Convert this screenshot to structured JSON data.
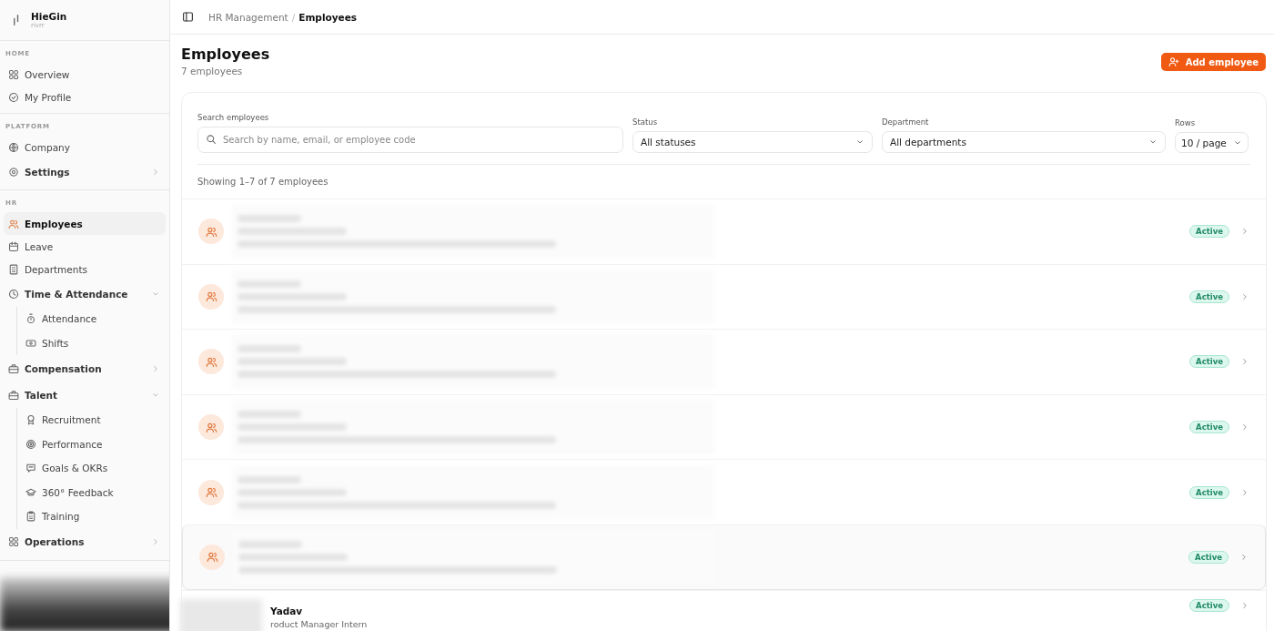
{
  "brand": {
    "name": "HieGin",
    "sub": "rivrr"
  },
  "sidebar": {
    "sections": [
      {
        "heading": "HOME",
        "items": [
          {
            "label": "Overview",
            "selected": false
          },
          {
            "label": "My Profile",
            "selected": false
          }
        ]
      },
      {
        "heading": "PLATFORM",
        "items": [
          {
            "label": "Company",
            "selected": false
          },
          {
            "label": "Settings",
            "selected": false,
            "expanded": false,
            "group": true
          }
        ]
      },
      {
        "heading": "HR",
        "items": [
          {
            "label": "Employees",
            "selected": true
          },
          {
            "label": "Leave",
            "selected": false
          },
          {
            "label": "Departments",
            "selected": false
          },
          {
            "label": "Time & Attendance",
            "selected": false,
            "group": true,
            "expanded": true,
            "children": [
              {
                "label": "Attendance",
                "selected": false
              },
              {
                "label": "Shifts",
                "selected": false
              }
            ]
          },
          {
            "label": "Compensation",
            "selected": false,
            "group": true,
            "expanded": false
          },
          {
            "label": "Talent",
            "selected": false,
            "group": true,
            "expanded": true,
            "children": [
              {
                "label": "Recruitment",
                "selected": false
              },
              {
                "label": "Performance",
                "selected": false
              },
              {
                "label": "Goals & OKRs",
                "selected": false
              },
              {
                "label": "360° Feedback",
                "selected": false
              },
              {
                "label": "Training",
                "selected": false
              }
            ]
          },
          {
            "label": "Operations",
            "selected": false,
            "group": true,
            "expanded": false
          }
        ]
      }
    ]
  },
  "breadcrumb": {
    "items": [
      "HR Management",
      "Employees"
    ],
    "separator": "/"
  },
  "page": {
    "title": "Employees",
    "subtitle": "7 employees",
    "action": "Add employee"
  },
  "filters": {
    "search": {
      "label": "Search employees",
      "placeholder": "Search by name, email, or employee code"
    },
    "status": {
      "label": "Status",
      "value": "All statuses"
    },
    "department": {
      "label": "Department",
      "value": "All departments"
    },
    "rows": {
      "label": "Rows",
      "value": "10 / page"
    }
  },
  "showing": "Showing 1–7 of 7 employees",
  "employees": [
    {
      "blurred": true,
      "status": "Active",
      "kind": "active",
      "selected": false
    },
    {
      "blurred": true,
      "status": "Active",
      "kind": "active",
      "selected": false
    },
    {
      "blurred": true,
      "status": "Active",
      "kind": "active",
      "selected": false
    },
    {
      "blurred": true,
      "status": "Active",
      "kind": "active",
      "selected": false
    },
    {
      "blurred": true,
      "status": "Active",
      "kind": "active",
      "selected": false
    },
    {
      "blurred": true,
      "status": "Active",
      "kind": "active",
      "selected": true
    },
    {
      "blurred": false,
      "name": "Yadav",
      "role": "roduct Manager Intern",
      "status": "Active",
      "kind": "active",
      "selected": false
    }
  ]
}
